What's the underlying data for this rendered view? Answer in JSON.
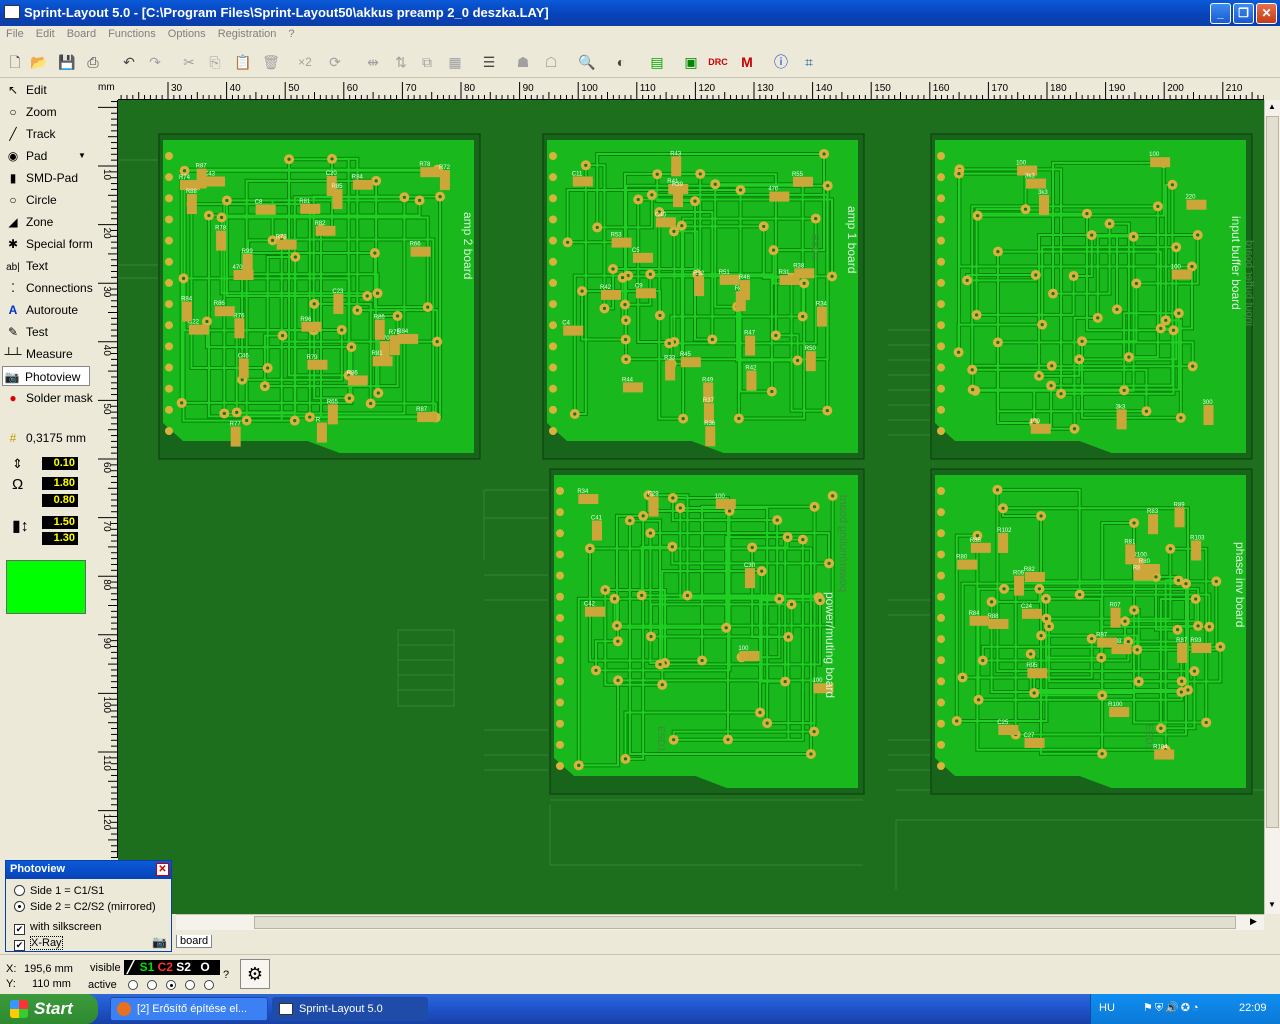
{
  "window": {
    "title": "Sprint-Layout 5.0 - [C:\\Program Files\\Sprint-Layout50\\akkus preamp 2_0 deszka.LAY]"
  },
  "menu": [
    "File",
    "Edit",
    "Board",
    "Functions",
    "Options",
    "Registration",
    "?"
  ],
  "tools": [
    {
      "label": "Edit",
      "icon": "arrow-icon"
    },
    {
      "label": "Zoom",
      "icon": "magnifier-icon"
    },
    {
      "label": "Track",
      "icon": "track-icon"
    },
    {
      "label": "Pad",
      "icon": "pad-icon"
    },
    {
      "label": "SMD-Pad",
      "icon": "smd-pad-icon"
    },
    {
      "label": "Circle",
      "icon": "circle-icon"
    },
    {
      "label": "Zone",
      "icon": "zone-icon"
    },
    {
      "label": "Special form",
      "icon": "special-form-icon"
    },
    {
      "label": "Text",
      "icon": "text-icon"
    },
    {
      "label": "Connections",
      "icon": "connections-icon"
    },
    {
      "label": "Autoroute",
      "icon": "autoroute-icon"
    },
    {
      "label": "Test",
      "icon": "test-icon"
    },
    {
      "label": "Measure",
      "icon": "measure-icon"
    },
    {
      "label": "Photoview",
      "icon": "photoview-icon"
    },
    {
      "label": "Solder mask",
      "icon": "solder-mask-icon"
    }
  ],
  "grid": "0,3175 mm",
  "params": {
    "track_width": "0.10",
    "pad_outer": "1.80",
    "pad_inner": "0.80",
    "smd_w": "1.50",
    "smd_h": "1.30"
  },
  "ruler": {
    "h_ticks": [
      "mm",
      "30",
      "40",
      "50",
      "60",
      "70",
      "80",
      "90",
      "100",
      "110",
      "120",
      "130",
      "140",
      "150",
      "160",
      "170",
      "180",
      "190",
      "200",
      "210"
    ],
    "v_ticks": [
      "10",
      "20",
      "30",
      "40",
      "50",
      "60",
      "70",
      "80",
      "90",
      "100",
      "110",
      "120"
    ]
  },
  "boards": {
    "amp2": "amp 2 board",
    "amp1": "amp 1 board",
    "input": "input buffer board",
    "power": "power/muting board",
    "phase": "phase inv board",
    "power_mirror": "power/muting board",
    "input_mirror": "input buffer board",
    "esd_labels": [
      "ESD1",
      "ESD1",
      "ESD1"
    ]
  },
  "parts_amp2": [
    "R78",
    "R79",
    "C46",
    "R70",
    "R",
    "R78",
    "R73",
    "C8",
    "C43",
    "470",
    "C22",
    "R74",
    "R82",
    "R84",
    "R66",
    "C20",
    "R81",
    "R72",
    "R85",
    "R86",
    "C23",
    "R84",
    "R75",
    "R87",
    "R65",
    "R77",
    "R76",
    "R88",
    "R87",
    "R81",
    "R96",
    "R84",
    "R86",
    "R86",
    "R99"
  ],
  "parts_amp1": [
    "R47",
    "R44",
    "C11",
    "R49",
    "R42",
    "C9",
    "C40",
    "470",
    "C4",
    "R41",
    "R43",
    "R45",
    "R50",
    "C5",
    "R55",
    "R53",
    "R51",
    "R37",
    "R39",
    "R40",
    "R46",
    "R38",
    "R42",
    "R36",
    "R31",
    "R34",
    "R33",
    "R32"
  ],
  "parts_input": [
    "100",
    "300",
    "100",
    "100",
    "100",
    "3k3",
    "3k3",
    "3k3",
    "220"
  ],
  "parts_power": [
    "C41",
    "100",
    "C42",
    "100",
    "C30",
    "100",
    "C29",
    "R34"
  ],
  "parts_phase": [
    "R103",
    "R102",
    "C24",
    "R07",
    "R08",
    "R100",
    "C27",
    "R104",
    "R100",
    "C25",
    "R93",
    "R06",
    "R97",
    "R95",
    "R89",
    "R81",
    "R88",
    "R89",
    "R83",
    "R80",
    "R80",
    "R84",
    "R82",
    "R86",
    "R87"
  ],
  "photoview": {
    "title": "Photoview",
    "side1": "Side 1 = C1/S1",
    "side2": "Side 2 = C2/S2 (mirrored)",
    "silkscreen": "with silkscreen",
    "xray": "X-Ray"
  },
  "tab": "board",
  "status": {
    "x_label": "X:",
    "x_value": "195,6 mm",
    "y_label": "Y:",
    "y_value": "110 mm",
    "visible": "visible",
    "active": "active",
    "layers": [
      "C1",
      "S1",
      "C2",
      "S2",
      "O"
    ],
    "question": "?"
  },
  "taskbar": {
    "start": "Start",
    "tasks": [
      "[2] Erősítő építése el...",
      "Sprint-Layout 5.0"
    ],
    "lang": "HU",
    "time": "22:09"
  }
}
